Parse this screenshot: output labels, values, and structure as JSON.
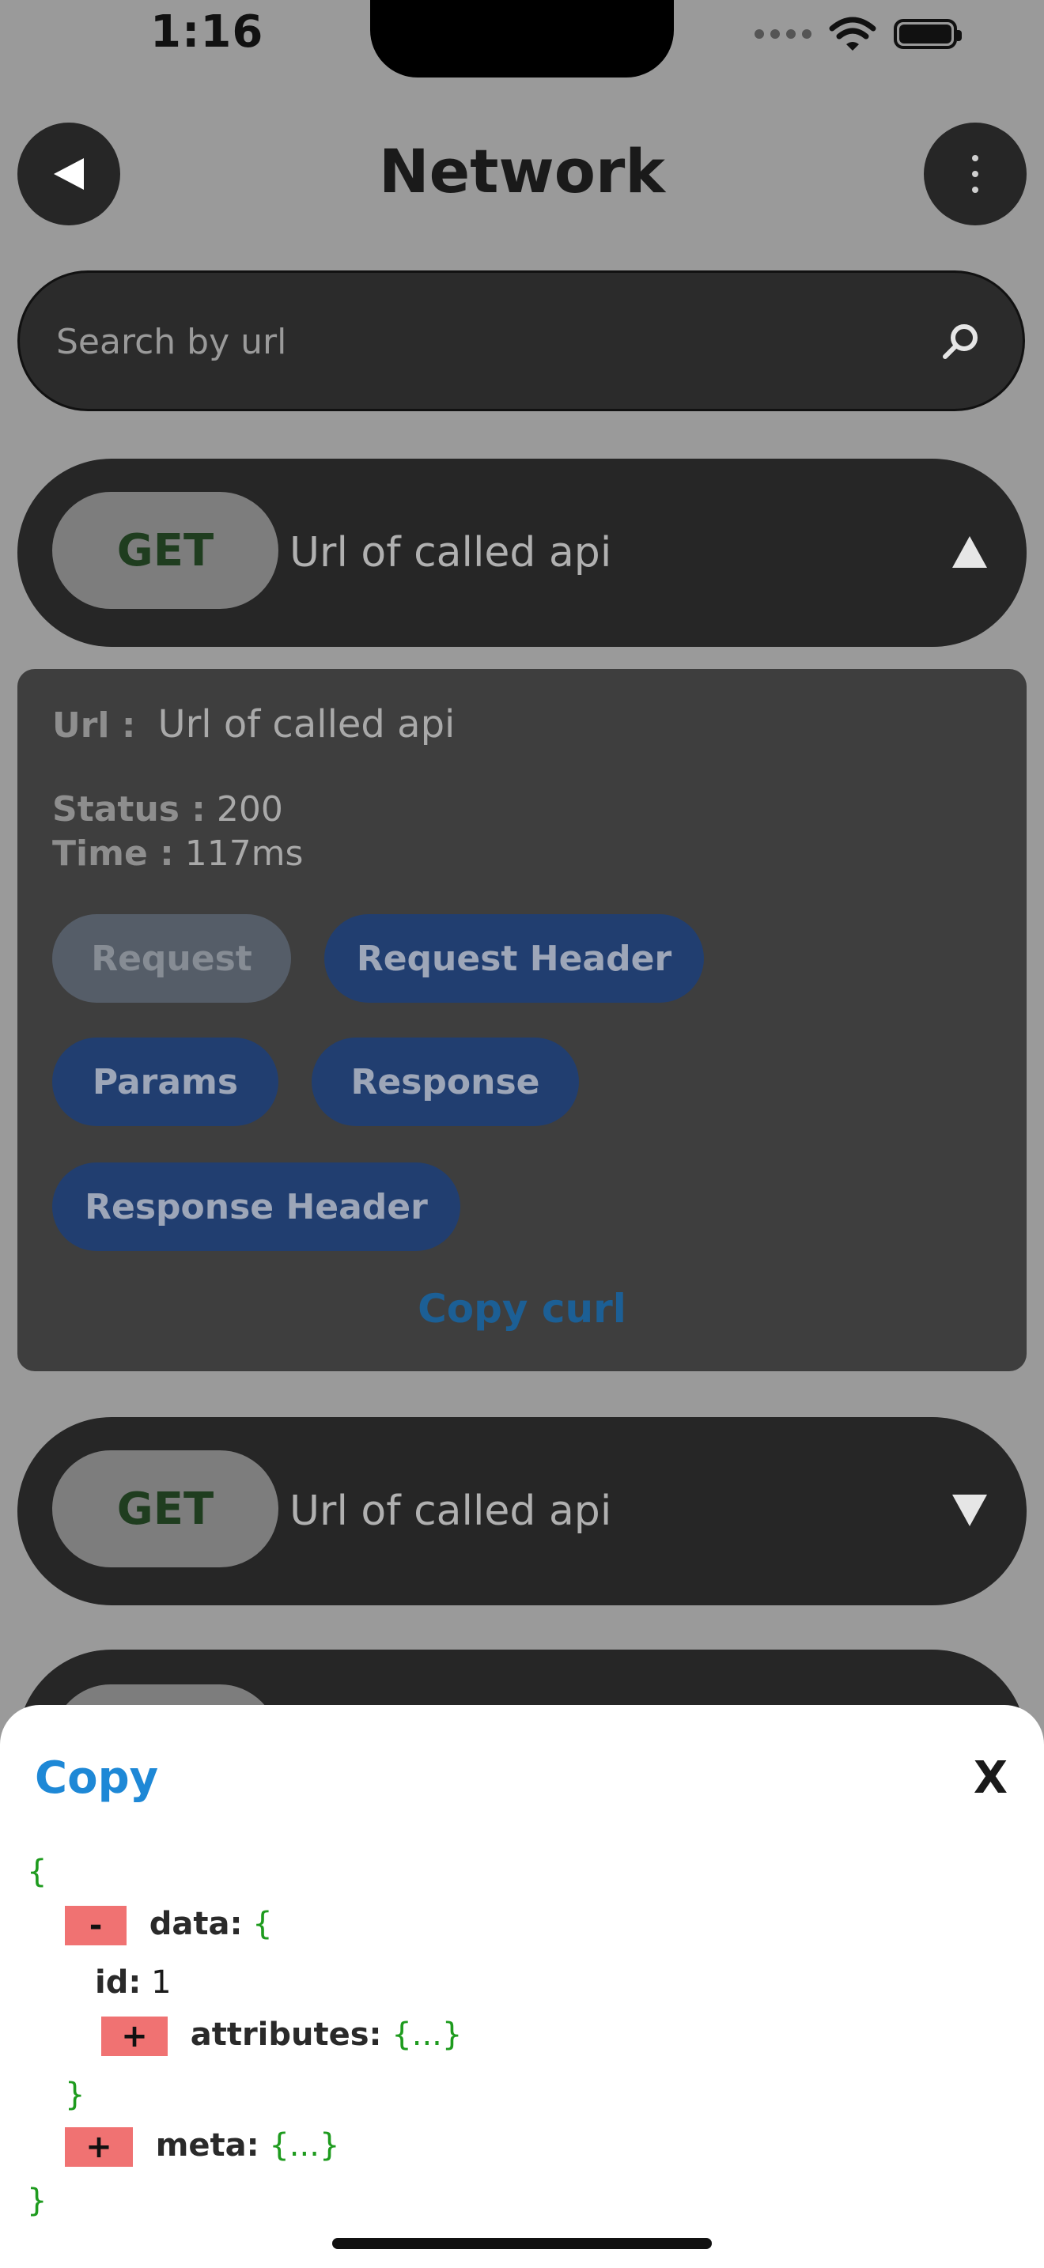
{
  "status_bar": {
    "time": "1:16"
  },
  "header": {
    "title": "Network"
  },
  "search": {
    "placeholder": "Search by url"
  },
  "requests": [
    {
      "method": "GET",
      "url": "Url of called api",
      "expanded": true
    },
    {
      "method": "GET",
      "url": "Url of called api",
      "expanded": false
    }
  ],
  "details": {
    "url_label": "Url :",
    "url_value": "Url of called api",
    "status_label": "Status :",
    "status_value": "200",
    "time_label": "Time :",
    "time_value": "117ms",
    "tabs": [
      "Request",
      "Request Header",
      "Params",
      "Response",
      "Response Header"
    ],
    "active_tab": "Request",
    "copy_curl": "Copy curl"
  },
  "sheet": {
    "copy_label": "Copy",
    "close_label": "X",
    "json": {
      "open_brace": "{",
      "close_brace": "}",
      "data_toggle": "-",
      "data_key": "data:",
      "data_open": "{",
      "id_key": "id:",
      "id_value": "1",
      "attributes_toggle": "+",
      "attributes_key": "attributes:",
      "attributes_collapsed": "{...}",
      "data_close": "}",
      "meta_toggle": "+",
      "meta_key": "meta:",
      "meta_collapsed": "{...}"
    }
  },
  "colors": {
    "background": "#9a9a9a",
    "method_text": "#1f3d1f",
    "tab_active": "#213e70",
    "copy_link": "#1e88d6",
    "json_brace": "#1e9b1e",
    "toggle": "#f07272"
  }
}
